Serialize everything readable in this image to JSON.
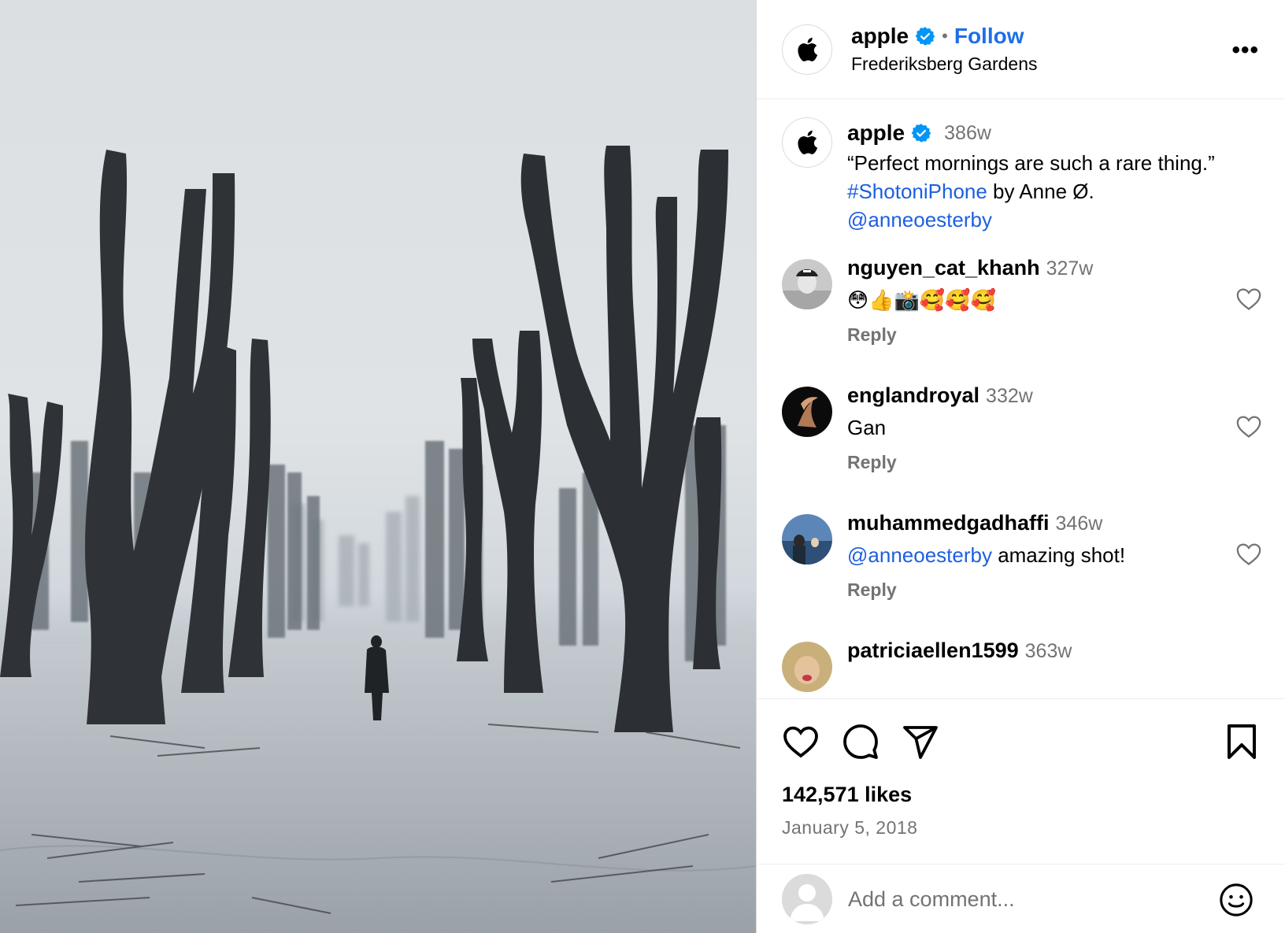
{
  "post": {
    "photo_alt": "",
    "header": {
      "username": "apple",
      "separator": "•",
      "follow_label": "Follow",
      "location": "Frederiksberg Gardens",
      "more_label": "•••"
    },
    "caption": {
      "username": "apple",
      "time": "386w",
      "text": "“Perfect mornings are such a rare thing.”",
      "hashtag": "#ShotoniPhone",
      "by_text": " by Anne Ø.",
      "mention": "@anneoesterby"
    },
    "comments": [
      {
        "username": "nguyen_cat_khanh",
        "time": "327w",
        "text": "😳👍📸🥰🥰🥰",
        "reply_label": "Reply"
      },
      {
        "username": "englandroyal",
        "time": "332w",
        "text": "Gan",
        "reply_label": "Reply"
      },
      {
        "username": "muhammedgadhaffi",
        "time": "346w",
        "mention": "@anneoesterby",
        "text": " amazing shot!",
        "reply_label": "Reply"
      },
      {
        "username": "patriciaellen1599",
        "time": "363w"
      }
    ],
    "likes": "142,571 likes",
    "date": "January 5, 2018",
    "add_comment_placeholder": "Add a comment..."
  },
  "colors": {
    "link": "#1d5fe0",
    "verified": "#0095f6",
    "muted": "#737373"
  },
  "icons": [
    "apple-logo-icon",
    "verified-badge-icon",
    "more-icon",
    "heart-icon",
    "comment-icon",
    "share-icon",
    "bookmark-icon",
    "emoji-icon"
  ]
}
